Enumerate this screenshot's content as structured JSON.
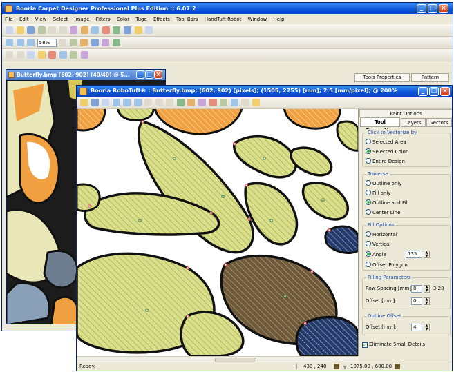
{
  "main_window": {
    "title": "Booria Carpet Designer Professional Plus Edition :: 6.07.2",
    "menu": [
      "File",
      "Edit",
      "View",
      "Select",
      "Image",
      "Filters",
      "Color",
      "Tuge",
      "Effects",
      "Tool Bars",
      "HandTuft Robot",
      "Window",
      "Help"
    ],
    "zoom_value": "58%",
    "document_title": "Butterfly.bmp [602, 902] (40/40)  @ 5...",
    "right_tabs": [
      "Tools Properties",
      "Pattern"
    ]
  },
  "robo_window": {
    "title": "Booria RoboTuft® : Butterfly.bmp; (602, 902) [pixels]; (1505, 2255) [mm]; 2.5 [mm/pixel]; @ 200%",
    "status_text": "Ready.",
    "status_coords": "430 , 240",
    "status_size": "1075.00 , 600.00"
  },
  "options_panel": {
    "header": "Paint Options",
    "tabs": [
      "Tool Properties",
      "Layers",
      "Vectors"
    ],
    "click_to_vectorize": {
      "title": "Click to Vectorize by",
      "options": [
        "Selected Area",
        "Selected Color",
        "Entire Design"
      ],
      "selected": 1
    },
    "traverse": {
      "title": "Traverse",
      "options": [
        "Outline only",
        "Fill only",
        "Outline and Fill",
        "Center Line"
      ],
      "selected": 2
    },
    "fill_options": {
      "title": "Fill Options",
      "options": [
        "Horizontal",
        "Vertical",
        "Angle",
        "Offset Polygon"
      ],
      "selected": 2,
      "angle_value": "135"
    },
    "filling_parameters": {
      "title": "Filling Parameters",
      "row_spacing_label": "Row Spacing [mm]:",
      "row_spacing_value": "8",
      "row_spacing_result": "3.20",
      "offset_label": "Offset [mm]:",
      "offset_value": "0"
    },
    "outline_offset": {
      "title": "Outline Offset",
      "offset_label": "Offset [mm]:",
      "offset_value": "4"
    },
    "eliminate_label": "Eliminate Small Details",
    "eliminate_checked": true
  },
  "colors": {
    "lime_fill": "#d9df8c",
    "stripe": "#a8b04a",
    "brown_fill": "#6e5a3a",
    "orange": "#f0a040",
    "navy": "#233a6a",
    "outline": "#111111"
  }
}
